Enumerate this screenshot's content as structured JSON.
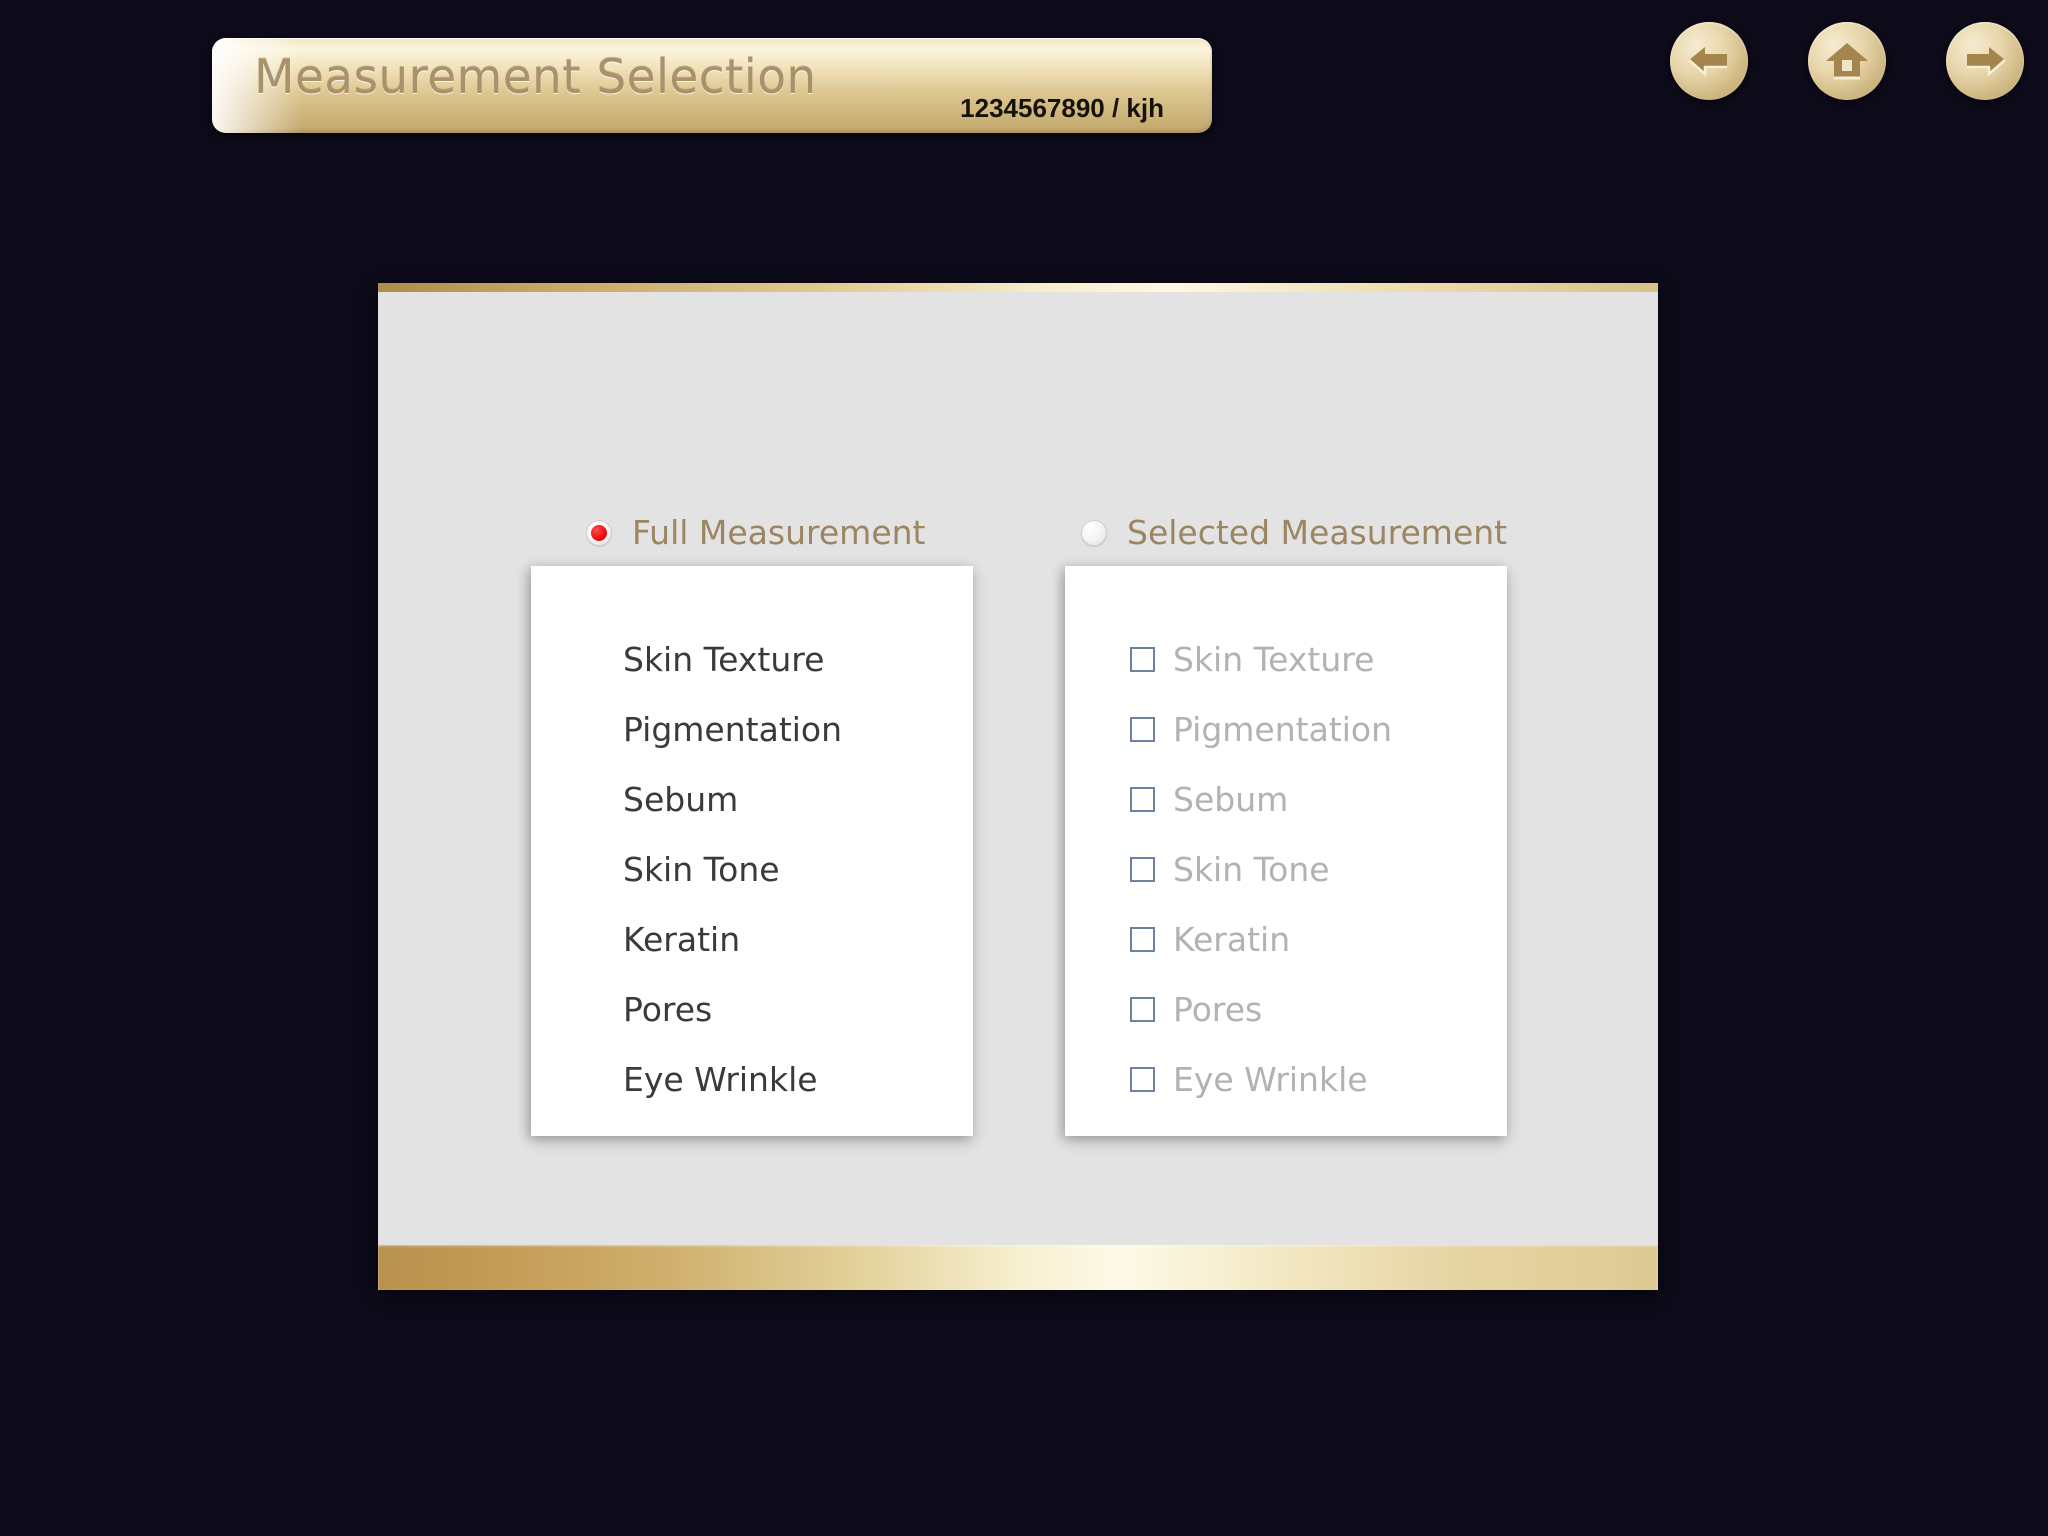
{
  "header": {
    "title": "Measurement Selection",
    "record_id": "1234567890 / kjh"
  },
  "nav": {
    "back_label": "Back",
    "home_label": "Home",
    "forward_label": "Forward"
  },
  "options": {
    "full": {
      "label": "Full Measurement",
      "selected": true
    },
    "selected": {
      "label": "Selected Measurement",
      "selected": false
    }
  },
  "full_list": {
    "items": [
      {
        "label": "Skin Texture"
      },
      {
        "label": "Pigmentation"
      },
      {
        "label": "Sebum"
      },
      {
        "label": "Skin Tone"
      },
      {
        "label": "Keratin"
      },
      {
        "label": "Pores"
      },
      {
        "label": "Eye Wrinkle"
      }
    ]
  },
  "selected_list": {
    "items": [
      {
        "label": "Skin Texture",
        "checked": false
      },
      {
        "label": "Pigmentation",
        "checked": false
      },
      {
        "label": "Sebum",
        "checked": false
      },
      {
        "label": "Skin Tone",
        "checked": false
      },
      {
        "label": "Keratin",
        "checked": false
      },
      {
        "label": "Pores",
        "checked": false
      },
      {
        "label": "Eye Wrinkle",
        "checked": false
      }
    ]
  },
  "colors": {
    "background": "#0d0a19",
    "panel": "#e3e3e3",
    "gold_light": "#fdf8e4",
    "gold_dark": "#b8924e",
    "radio_selected": "#ee1111",
    "label_gold": "#9b8562",
    "checkbox_border": "#6d81a0",
    "label_disabled": "#b2b2b2"
  }
}
